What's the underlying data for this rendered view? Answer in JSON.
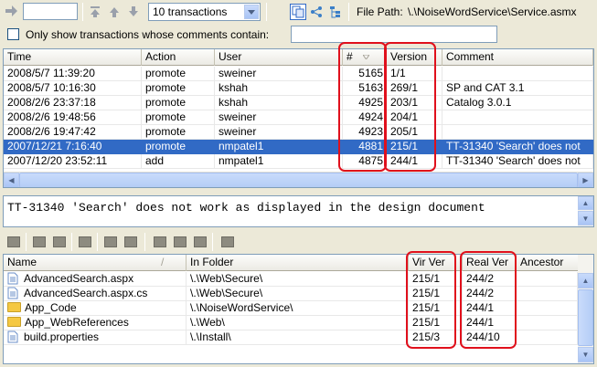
{
  "toolbar": {
    "transaction_input_value": "",
    "transactions_select": "10 transactions",
    "file_path_label": "File Path:",
    "file_path_value": "\\.\\NoiseWordService\\Service.asmx"
  },
  "filter": {
    "checkbox_label": "Only show transactions whose comments contain:",
    "checked": false,
    "text_value": ""
  },
  "transactions": {
    "columns": {
      "time": "Time",
      "action": "Action",
      "user": "User",
      "number": "#",
      "version": "Version",
      "comment": "Comment"
    },
    "rows": [
      {
        "time": "2008/5/7 11:39:20",
        "action": "promote",
        "user": "sweiner",
        "number": "5165",
        "version": "1/1",
        "comment": ""
      },
      {
        "time": "2008/5/7 10:16:30",
        "action": "promote",
        "user": "kshah",
        "number": "5163",
        "version": "269/1",
        "comment": "SP and CAT 3.1"
      },
      {
        "time": "2008/2/6 23:37:18",
        "action": "promote",
        "user": "kshah",
        "number": "4925",
        "version": "203/1",
        "comment": "Catalog 3.0.1"
      },
      {
        "time": "2008/2/6 19:48:56",
        "action": "promote",
        "user": "sweiner",
        "number": "4924",
        "version": "204/1",
        "comment": ""
      },
      {
        "time": "2008/2/6 19:47:42",
        "action": "promote",
        "user": "sweiner",
        "number": "4923",
        "version": "205/1",
        "comment": ""
      },
      {
        "time": "2007/12/21 7:16:40",
        "action": "promote",
        "user": "nmpatel1",
        "number": "4881",
        "version": "215/1",
        "comment": "TT-31340 'Search' does not",
        "selected": true
      },
      {
        "time": "2007/12/20 23:52:11",
        "action": "add",
        "user": "nmpatel1",
        "number": "4875",
        "version": "244/1",
        "comment": "TT-31340 'Search' does not"
      }
    ]
  },
  "comment_preview": {
    "text": "TT-31340 'Search' does not work as displayed in the design document"
  },
  "files": {
    "columns": {
      "name": "Name",
      "in_folder": "In Folder",
      "vir_ver": "Vir Ver",
      "real_ver": "Real Ver",
      "ancestor": "Ancestor"
    },
    "rows": [
      {
        "icon": "file-icon",
        "name": "AdvancedSearch.aspx",
        "in_folder": "\\.\\Web\\Secure\\",
        "vir_ver": "215/1",
        "real_ver": "244/2",
        "ancestor": ""
      },
      {
        "icon": "file-icon",
        "name": "AdvancedSearch.aspx.cs",
        "in_folder": "\\.\\Web\\Secure\\",
        "vir_ver": "215/1",
        "real_ver": "244/2",
        "ancestor": ""
      },
      {
        "icon": "folder-icon",
        "name": "App_Code",
        "in_folder": "\\.\\NoiseWordService\\",
        "vir_ver": "215/1",
        "real_ver": "244/1",
        "ancestor": ""
      },
      {
        "icon": "folder-icon",
        "name": "App_WebReferences",
        "in_folder": "\\.\\Web\\",
        "vir_ver": "215/1",
        "real_ver": "244/1",
        "ancestor": ""
      },
      {
        "icon": "file-icon",
        "name": "build.properties",
        "in_folder": "\\.\\Install\\",
        "vir_ver": "215/3",
        "real_ver": "244/10",
        "ancestor": ""
      }
    ]
  },
  "colors": {
    "selection": "#316ac5",
    "highlight_box": "#e0101c",
    "window_bg": "#ece9d8"
  }
}
